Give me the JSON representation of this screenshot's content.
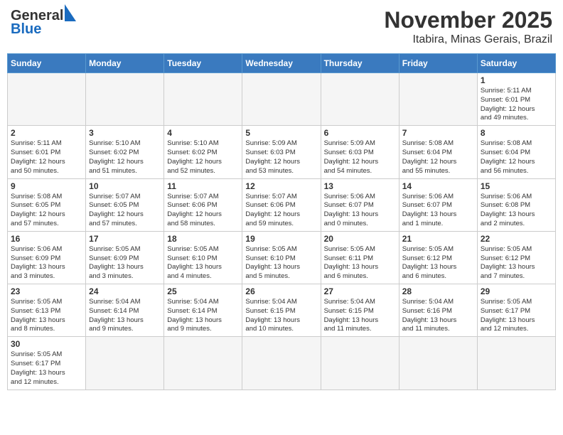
{
  "header": {
    "logo_general": "General",
    "logo_blue": "Blue",
    "month_title": "November 2025",
    "location": "Itabira, Minas Gerais, Brazil"
  },
  "weekdays": [
    "Sunday",
    "Monday",
    "Tuesday",
    "Wednesday",
    "Thursday",
    "Friday",
    "Saturday"
  ],
  "days": [
    {
      "date": "",
      "info": ""
    },
    {
      "date": "",
      "info": ""
    },
    {
      "date": "",
      "info": ""
    },
    {
      "date": "",
      "info": ""
    },
    {
      "date": "",
      "info": ""
    },
    {
      "date": "",
      "info": ""
    },
    {
      "date": "1",
      "info": "Sunrise: 5:11 AM\nSunset: 6:01 PM\nDaylight: 12 hours\nand 49 minutes."
    },
    {
      "date": "2",
      "info": "Sunrise: 5:11 AM\nSunset: 6:01 PM\nDaylight: 12 hours\nand 50 minutes."
    },
    {
      "date": "3",
      "info": "Sunrise: 5:10 AM\nSunset: 6:02 PM\nDaylight: 12 hours\nand 51 minutes."
    },
    {
      "date": "4",
      "info": "Sunrise: 5:10 AM\nSunset: 6:02 PM\nDaylight: 12 hours\nand 52 minutes."
    },
    {
      "date": "5",
      "info": "Sunrise: 5:09 AM\nSunset: 6:03 PM\nDaylight: 12 hours\nand 53 minutes."
    },
    {
      "date": "6",
      "info": "Sunrise: 5:09 AM\nSunset: 6:03 PM\nDaylight: 12 hours\nand 54 minutes."
    },
    {
      "date": "7",
      "info": "Sunrise: 5:08 AM\nSunset: 6:04 PM\nDaylight: 12 hours\nand 55 minutes."
    },
    {
      "date": "8",
      "info": "Sunrise: 5:08 AM\nSunset: 6:04 PM\nDaylight: 12 hours\nand 56 minutes."
    },
    {
      "date": "9",
      "info": "Sunrise: 5:08 AM\nSunset: 6:05 PM\nDaylight: 12 hours\nand 57 minutes."
    },
    {
      "date": "10",
      "info": "Sunrise: 5:07 AM\nSunset: 6:05 PM\nDaylight: 12 hours\nand 57 minutes."
    },
    {
      "date": "11",
      "info": "Sunrise: 5:07 AM\nSunset: 6:06 PM\nDaylight: 12 hours\nand 58 minutes."
    },
    {
      "date": "12",
      "info": "Sunrise: 5:07 AM\nSunset: 6:06 PM\nDaylight: 12 hours\nand 59 minutes."
    },
    {
      "date": "13",
      "info": "Sunrise: 5:06 AM\nSunset: 6:07 PM\nDaylight: 13 hours\nand 0 minutes."
    },
    {
      "date": "14",
      "info": "Sunrise: 5:06 AM\nSunset: 6:07 PM\nDaylight: 13 hours\nand 1 minute."
    },
    {
      "date": "15",
      "info": "Sunrise: 5:06 AM\nSunset: 6:08 PM\nDaylight: 13 hours\nand 2 minutes."
    },
    {
      "date": "16",
      "info": "Sunrise: 5:06 AM\nSunset: 6:09 PM\nDaylight: 13 hours\nand 3 minutes."
    },
    {
      "date": "17",
      "info": "Sunrise: 5:05 AM\nSunset: 6:09 PM\nDaylight: 13 hours\nand 3 minutes."
    },
    {
      "date": "18",
      "info": "Sunrise: 5:05 AM\nSunset: 6:10 PM\nDaylight: 13 hours\nand 4 minutes."
    },
    {
      "date": "19",
      "info": "Sunrise: 5:05 AM\nSunset: 6:10 PM\nDaylight: 13 hours\nand 5 minutes."
    },
    {
      "date": "20",
      "info": "Sunrise: 5:05 AM\nSunset: 6:11 PM\nDaylight: 13 hours\nand 6 minutes."
    },
    {
      "date": "21",
      "info": "Sunrise: 5:05 AM\nSunset: 6:12 PM\nDaylight: 13 hours\nand 6 minutes."
    },
    {
      "date": "22",
      "info": "Sunrise: 5:05 AM\nSunset: 6:12 PM\nDaylight: 13 hours\nand 7 minutes."
    },
    {
      "date": "23",
      "info": "Sunrise: 5:05 AM\nSunset: 6:13 PM\nDaylight: 13 hours\nand 8 minutes."
    },
    {
      "date": "24",
      "info": "Sunrise: 5:04 AM\nSunset: 6:14 PM\nDaylight: 13 hours\nand 9 minutes."
    },
    {
      "date": "25",
      "info": "Sunrise: 5:04 AM\nSunset: 6:14 PM\nDaylight: 13 hours\nand 9 minutes."
    },
    {
      "date": "26",
      "info": "Sunrise: 5:04 AM\nSunset: 6:15 PM\nDaylight: 13 hours\nand 10 minutes."
    },
    {
      "date": "27",
      "info": "Sunrise: 5:04 AM\nSunset: 6:15 PM\nDaylight: 13 hours\nand 11 minutes."
    },
    {
      "date": "28",
      "info": "Sunrise: 5:04 AM\nSunset: 6:16 PM\nDaylight: 13 hours\nand 11 minutes."
    },
    {
      "date": "29",
      "info": "Sunrise: 5:05 AM\nSunset: 6:17 PM\nDaylight: 13 hours\nand 12 minutes."
    },
    {
      "date": "30",
      "info": "Sunrise: 5:05 AM\nSunset: 6:17 PM\nDaylight: 13 hours\nand 12 minutes."
    },
    {
      "date": "",
      "info": ""
    },
    {
      "date": "",
      "info": ""
    },
    {
      "date": "",
      "info": ""
    },
    {
      "date": "",
      "info": ""
    },
    {
      "date": "",
      "info": ""
    },
    {
      "date": "",
      "info": ""
    }
  ]
}
